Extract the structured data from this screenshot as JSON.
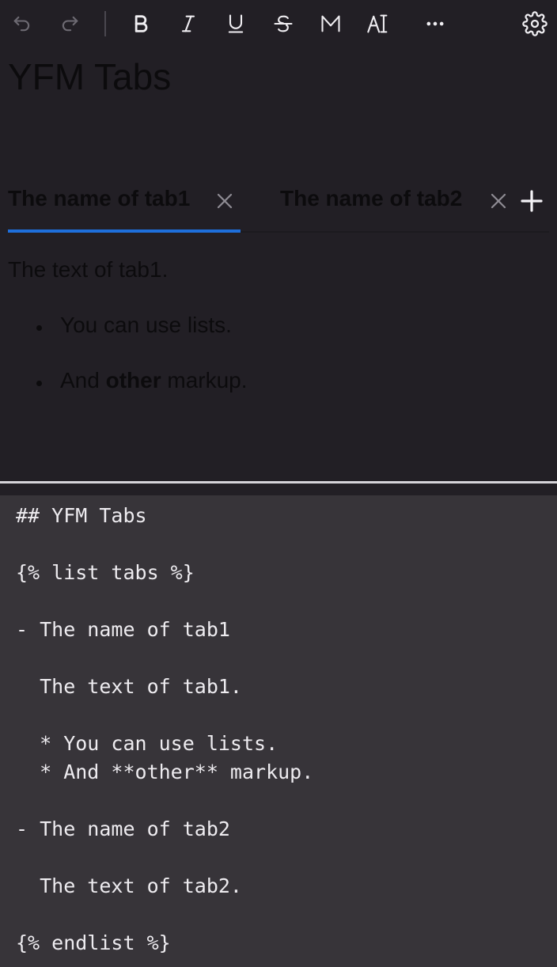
{
  "toolbar": {
    "buttons": [
      {
        "name": "undo",
        "icon": "undo-icon",
        "enabled": false
      },
      {
        "name": "redo",
        "icon": "redo-icon",
        "enabled": false
      },
      {
        "name": "bold",
        "icon": "bold-icon"
      },
      {
        "name": "italic",
        "icon": "italic-icon"
      },
      {
        "name": "underline",
        "icon": "underline-icon"
      },
      {
        "name": "strikethrough",
        "icon": "strikethrough-icon"
      },
      {
        "name": "mono",
        "icon": "monospace-icon"
      },
      {
        "name": "text-style",
        "icon": "text-style-icon"
      },
      {
        "name": "more",
        "icon": "more-horizontal-icon"
      },
      {
        "name": "settings",
        "icon": "gear-icon"
      }
    ]
  },
  "preview": {
    "heading": "YFM Tabs",
    "tabs": [
      {
        "label": "The name of tab1",
        "active": true
      },
      {
        "label": "The name of tab2",
        "active": false
      }
    ],
    "tab_text": "The text of tab1.",
    "list": [
      {
        "before": "You can use lists.",
        "bold": "",
        "after": ""
      },
      {
        "before": "And ",
        "bold": "other",
        "after": " markup."
      }
    ]
  },
  "source": {
    "lines": [
      "## YFM Tabs",
      "",
      "{% list tabs %}",
      "",
      "- The name of tab1",
      "",
      "  The text of tab1.",
      "",
      "  * You can use lists.",
      "  * And **other** markup.",
      "",
      "- The name of tab2",
      "",
      "  The text of tab2.",
      "",
      "{% endlist %}"
    ]
  },
  "colors": {
    "background": "#221f25",
    "source_background": "#373439",
    "accent": "#1e6fdc",
    "preview_text": "#0c0b0d",
    "source_text": "#eeecf0"
  }
}
